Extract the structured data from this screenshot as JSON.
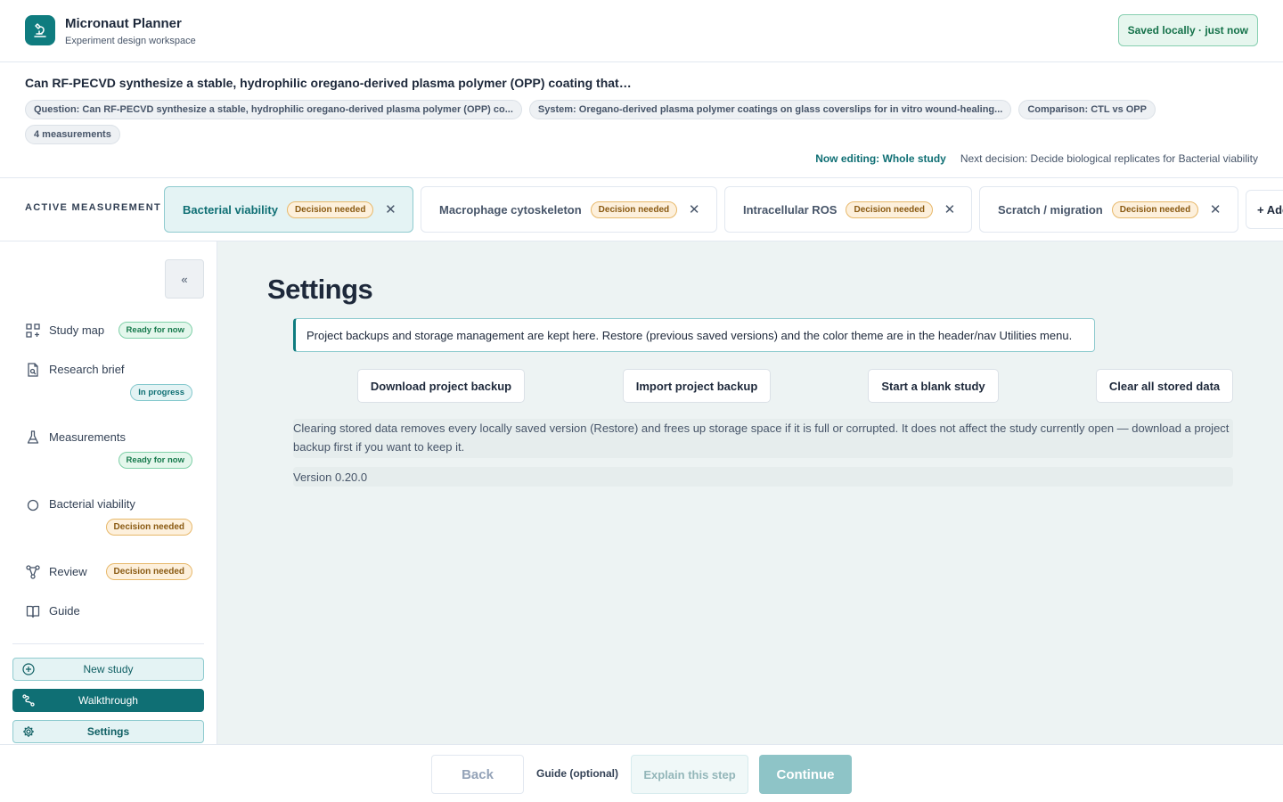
{
  "header": {
    "app_name": "Micronaut Planner",
    "app_subtitle": "Experiment design workspace",
    "logo_icon": "microscope-icon",
    "saved_status": "Saved locally · just now"
  },
  "study": {
    "title": "Can RF-PECVD synthesize a stable, hydrophilic oregano-derived plasma polymer (OPP) coating that…",
    "chips": [
      "Question: Can RF-PECVD synthesize a stable, hydrophilic oregano-derived plasma polymer (OPP) co...",
      "System: Oregano-derived plasma polymer coatings on glass coverslips for in vitro wound-healing...",
      "Comparison: CTL vs OPP",
      "4 measurements"
    ],
    "now_editing": "Now editing: Whole study",
    "next_decision": "Next decision: Decide biological replicates for Bacterial viability"
  },
  "measurements": {
    "label": "ACTIVE MEASUREMENT",
    "tabs": [
      {
        "label": "Bacterial viability",
        "badge": "Decision needed",
        "active": true
      },
      {
        "label": "Macrophage cytoskeleton",
        "badge": "Decision needed",
        "active": false
      },
      {
        "label": "Intracellular ROS",
        "badge": "Decision needed",
        "active": false
      },
      {
        "label": "Scratch / migration",
        "badge": "Decision needed",
        "active": false
      }
    ],
    "add_label": "+ Add"
  },
  "sidebar": {
    "collapse_label": "«",
    "items": [
      {
        "label": "Study map",
        "badge": "Ready for now",
        "icon": "grid-icon"
      },
      {
        "label": "Research brief",
        "badge": "In progress",
        "icon": "document-search-icon"
      },
      {
        "label": "Measurements",
        "badge": "Ready for now",
        "icon": "flask-icon"
      },
      {
        "label": "Bacterial viability",
        "badge": "Decision needed",
        "icon": "circle-icon"
      },
      {
        "label": "Review",
        "badge": "Decision needed",
        "icon": "network-icon"
      },
      {
        "label": "Guide",
        "badge": "",
        "icon": "book-icon"
      }
    ],
    "buttons": {
      "new_study": "New study",
      "walkthrough": "Walkthrough",
      "settings": "Settings"
    }
  },
  "main": {
    "title": "Settings",
    "info": "Project backups and storage management are kept here. Restore (previous saved versions) and the color theme are in the header/nav Utilities menu.",
    "actions": {
      "download": "Download project backup",
      "import": "Import project backup",
      "blank": "Start a blank study",
      "clear": "Clear all stored data"
    },
    "note": "Clearing stored data removes every locally saved version (Restore) and frees up storage space if it is full or corrupted. It does not affect the study currently open — download a project backup first if you want to keep it.",
    "version": "Version 0.20.0"
  },
  "footer": {
    "back": "Back",
    "guide": "Guide (optional)",
    "explain": "Explain this step",
    "continue": "Continue"
  },
  "colors": {
    "accent": "#0f7c7f",
    "accent_dark": "#0f6f74",
    "ready": "#177a4d",
    "decision": "#8a5a12",
    "main_bg": "#edf3f3"
  }
}
